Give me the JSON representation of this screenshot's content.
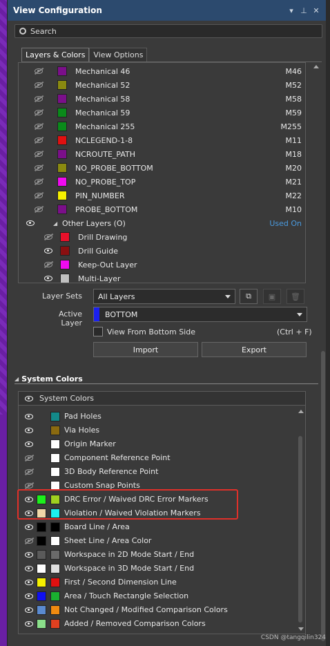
{
  "panel": {
    "title": "View Configuration",
    "search_placeholder": "Search"
  },
  "tabs": [
    {
      "label": "Layers & Colors",
      "active": true
    },
    {
      "label": "View Options",
      "active": false
    }
  ],
  "layers": [
    {
      "name": "Mechanical 46",
      "code": "M46",
      "color": "#7b0f8a",
      "visible": false
    },
    {
      "name": "Mechanical 52",
      "code": "M52",
      "color": "#8a8a10",
      "visible": false
    },
    {
      "name": "Mechanical 58",
      "code": "M58",
      "color": "#7b0f8a",
      "visible": false
    },
    {
      "name": "Mechanical 59",
      "code": "M59",
      "color": "#0a8a1a",
      "visible": false
    },
    {
      "name": "Mechanical 255",
      "code": "M255",
      "color": "#0a8a1a",
      "visible": false
    },
    {
      "name": "NCLEGEND-1-8",
      "code": "M11",
      "color": "#e01010",
      "visible": false
    },
    {
      "name": "NCROUTE_PATH",
      "code": "M18",
      "color": "#7b0f8a",
      "visible": false
    },
    {
      "name": "NO_PROBE_BOTTOM",
      "code": "M20",
      "color": "#8a8a10",
      "visible": false
    },
    {
      "name": "NO_PROBE_TOP",
      "code": "M21",
      "color": "#f00af0",
      "visible": false
    },
    {
      "name": "PIN_NUMBER",
      "code": "M22",
      "color": "#f5f000",
      "visible": false
    },
    {
      "name": "PROBE_BOTTOM",
      "code": "M10",
      "color": "#7b0f8a",
      "visible": false
    }
  ],
  "other_layers": {
    "label": "Other Layers (O)",
    "status": "Used On",
    "items": [
      {
        "name": "Drill Drawing",
        "color": "#e8102a",
        "visible": false
      },
      {
        "name": "Drill Guide",
        "color": "#8a0f10",
        "visible": true
      },
      {
        "name": "Keep-Out Layer",
        "color": "#f00af0",
        "visible": false
      },
      {
        "name": "Multi-Layer",
        "color": "#c0c0c0",
        "visible": true
      }
    ]
  },
  "controls": {
    "layer_sets_label": "Layer Sets",
    "layer_sets_value": "All Layers",
    "active_layer_label": "Active Layer",
    "active_layer_value": "BOTTOM",
    "active_layer_color": "#1a20f0",
    "view_bottom_label": "View From Bottom Side",
    "view_bottom_shortcut": "(Ctrl + F)",
    "view_bottom_checked": false,
    "import_label": "Import",
    "export_label": "Export"
  },
  "system_colors": {
    "section_title": "System Colors",
    "header": "System Colors",
    "items": [
      {
        "name": "Pad Holes",
        "c1": null,
        "c2": "#138a8a",
        "visible": true
      },
      {
        "name": "Via Holes",
        "c1": null,
        "c2": "#8a6a10",
        "visible": true
      },
      {
        "name": "Origin Marker",
        "c1": null,
        "c2": "#ffffff",
        "visible": true
      },
      {
        "name": "Component Reference Point",
        "c1": null,
        "c2": "#ffffff",
        "visible": false
      },
      {
        "name": "3D Body Reference Point",
        "c1": null,
        "c2": "#ffffff",
        "visible": false
      },
      {
        "name": "Custom Snap Points",
        "c1": null,
        "c2": "#ffffff",
        "visible": false
      },
      {
        "name": "DRC Error / Waived DRC Error Markers",
        "c1": "#1cf01c",
        "c2": "#a0d020",
        "visible": true
      },
      {
        "name": "Violation / Waived Violation Markers",
        "c1": "#f0d8a8",
        "c2": "#1cf0f0",
        "visible": true
      },
      {
        "name": "Board Line / Area",
        "c1": "#000000",
        "c2": "#000000",
        "visible": true
      },
      {
        "name": "Sheet Line / Area Color",
        "c1": "#000000",
        "c2": "#ffffff",
        "visible": false
      },
      {
        "name": "Workspace in 2D Mode Start / End",
        "c1": "#5a5a5a",
        "c2": "#6a6a6a",
        "visible": true
      },
      {
        "name": "Workspace in 3D Mode Start / End",
        "c1": "#ffffff",
        "c2": "#e0e0e0",
        "visible": true
      },
      {
        "name": "First / Second Dimension Line",
        "c1": "#f5f000",
        "c2": "#e01010",
        "visible": true
      },
      {
        "name": "Area / Touch Rectangle Selection",
        "c1": "#1010f0",
        "c2": "#1ab030",
        "visible": true
      },
      {
        "name": "Not Changed / Modified Comparison Colors",
        "c1": "#5a8ad0",
        "c2": "#f08a10",
        "visible": true
      },
      {
        "name": "Added / Removed Comparison Colors",
        "c1": "#8ae08a",
        "c2": "#e04020",
        "visible": true
      }
    ]
  },
  "watermark": "CSDN @tangqilin324"
}
